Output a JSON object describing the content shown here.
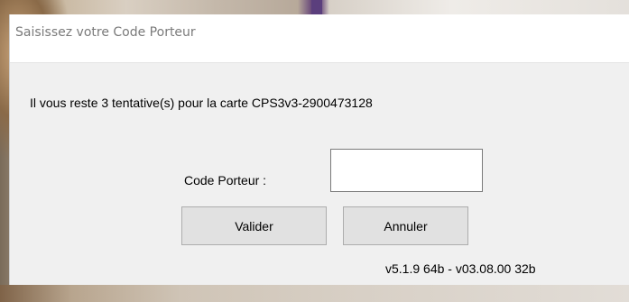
{
  "window": {
    "title": "Saisissez votre Code Porteur"
  },
  "dialog": {
    "message": "Il vous reste 3 tentative(s) pour la carte CPS3v3-2900473128",
    "code_label": "Code Porteur :",
    "code_value": "",
    "ok_label": "Valider",
    "cancel_label": "Annuler",
    "version": "v5.1.9 64b - v03.08.00 32b"
  }
}
